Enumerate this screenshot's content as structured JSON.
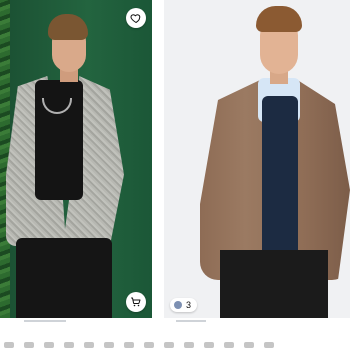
{
  "product_cards": [
    {
      "wishlist_icon": "heart-icon",
      "add_to_cart_icon": "cart-icon"
    },
    {
      "variants_count": "3",
      "variant_icon": "color-dot-icon"
    }
  ],
  "colors": {
    "left_bg": "#1f5b3b",
    "right_bg": "#f0f1f3",
    "badge_bg": "#ffffff",
    "page_indicator": "#cfd3d8"
  }
}
